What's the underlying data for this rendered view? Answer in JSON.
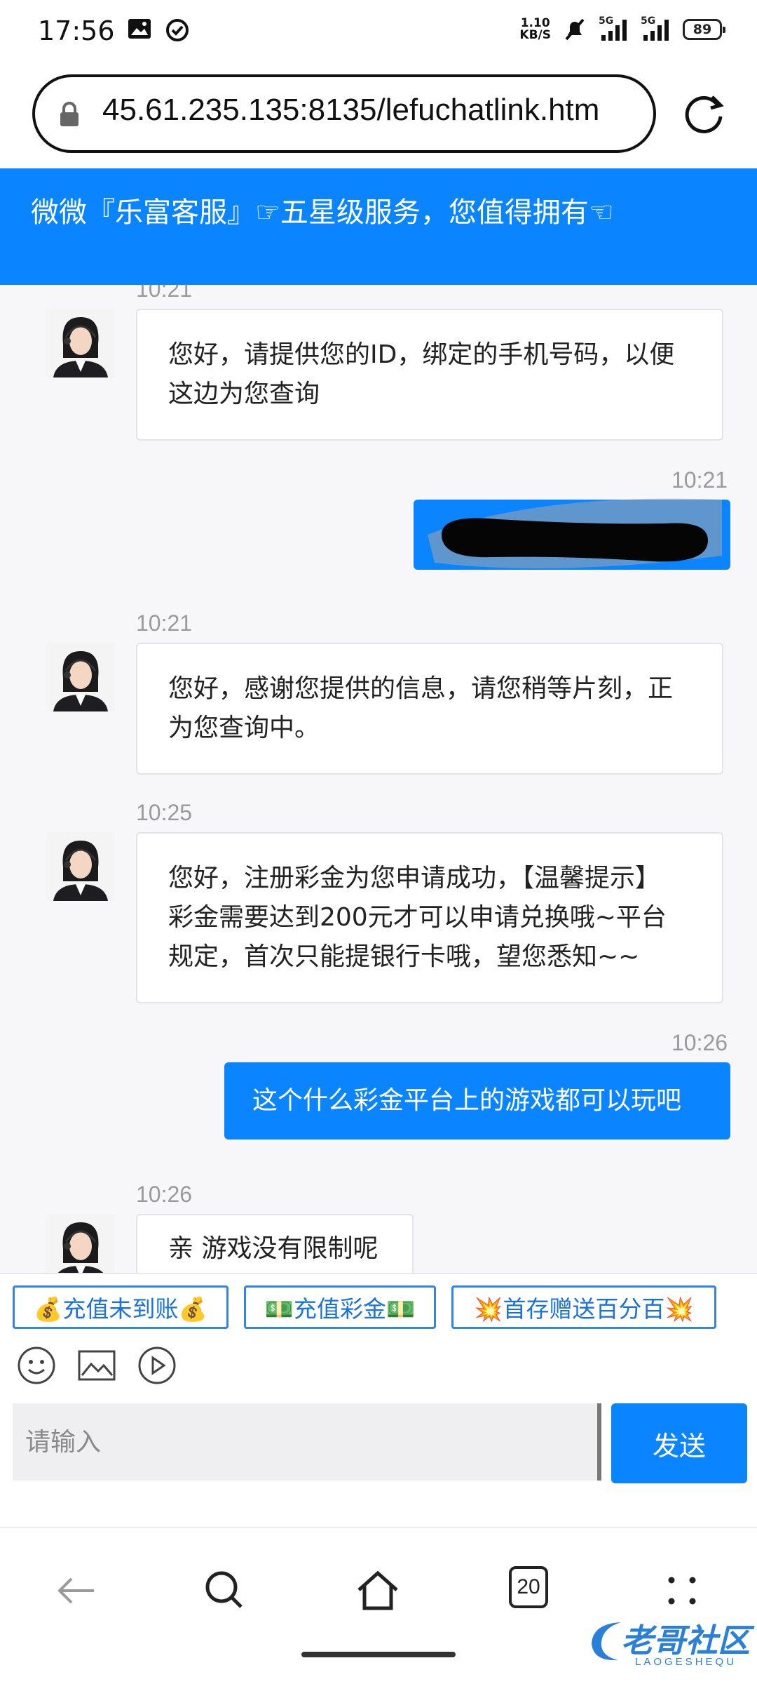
{
  "status_bar": {
    "time": "17:56",
    "net_speed_value": "1.10",
    "net_speed_unit": "KB/S",
    "signal_1_label": "5G",
    "signal_2_label": "5G",
    "battery": "89",
    "icons": [
      "image-icon",
      "check-circle-icon",
      "mute-icon",
      "signal-icon",
      "signal-icon",
      "battery-icon"
    ]
  },
  "browser": {
    "url": "45.61.235.135:8135/lefuchatlink.htm",
    "tab_count": "20"
  },
  "header": {
    "title": "微微『乐富客服』☞五星级服务，您值得拥有☜"
  },
  "messages": [
    {
      "from": "agent",
      "time": "10:21",
      "text_lines": [
        "您好，请提供您的ID，绑定的手机号码，以便",
        "这边为您查询"
      ]
    },
    {
      "from": "user",
      "time": "10:21",
      "redacted": true
    },
    {
      "from": "agent",
      "time": "10:21",
      "text_lines": [
        "您好，感谢您提供的信息，请您稍等片刻，正",
        "为您查询中。"
      ]
    },
    {
      "from": "agent",
      "time": "10:25",
      "text_lines": [
        "您好，注册彩金为您申请成功，【温馨提示】",
        "彩金需要达到200元才可以申请兑换哦~平台",
        "规定，首次只能提银行卡哦，望您悉知~~"
      ]
    },
    {
      "from": "user",
      "time": "10:26",
      "text": "这个什么彩金平台上的游戏都可以玩吧"
    },
    {
      "from": "agent",
      "time": "10:26",
      "text_lines": [
        "亲 游戏没有限制呢"
      ]
    }
  ],
  "quick_replies": [
    "💰充值未到账💰",
    "💵充值彩金💵",
    "💥首存赠送百分百💥"
  ],
  "composer": {
    "placeholder": "请输入",
    "send_label": "发送"
  },
  "watermark": {
    "text": "老哥社区",
    "sub": "LAOGESHEQU"
  },
  "colors": {
    "accent": "#0b84ff",
    "chat_bg": "#f7f7f9"
  }
}
